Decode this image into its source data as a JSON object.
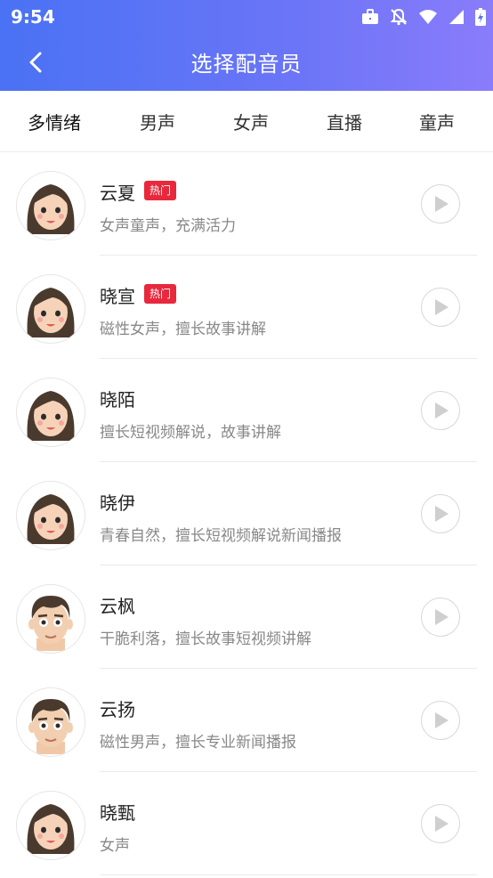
{
  "status_bar": {
    "time": "9:54"
  },
  "header": {
    "title": "选择配音员"
  },
  "tabs": [
    {
      "label": "多情绪"
    },
    {
      "label": "男声"
    },
    {
      "label": "女声"
    },
    {
      "label": "直播"
    },
    {
      "label": "童声"
    }
  ],
  "voices": [
    {
      "name": "云夏",
      "badge": "热门",
      "desc": "女声童声，充满活力",
      "avatar": "female"
    },
    {
      "name": "晓宣",
      "badge": "热门",
      "desc": "磁性女声，擅长故事讲解",
      "avatar": "female"
    },
    {
      "name": "晓陌",
      "badge": "",
      "desc": "擅长短视频解说，故事讲解",
      "avatar": "female"
    },
    {
      "name": "晓伊",
      "badge": "",
      "desc": "青春自然，擅长短视频解说新闻播报",
      "avatar": "female"
    },
    {
      "name": "云枫",
      "badge": "",
      "desc": "干脆利落，擅长故事短视频讲解",
      "avatar": "male"
    },
    {
      "name": "云扬",
      "badge": "",
      "desc": "磁性男声，擅长专业新闻播报",
      "avatar": "male"
    },
    {
      "name": "晓甄",
      "badge": "",
      "desc": "女声",
      "avatar": "female"
    }
  ],
  "colors": {
    "header_start": "#4a72f4",
    "header_end": "#8a7cfb",
    "badge": "#e8283c"
  }
}
